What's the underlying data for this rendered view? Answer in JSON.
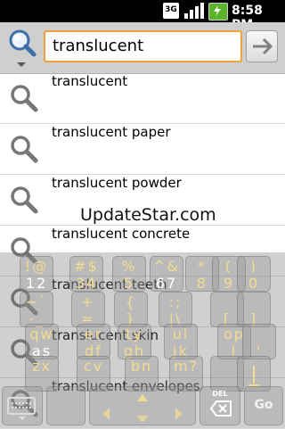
{
  "status_bar": {
    "network": "3G",
    "time": "8:58 PM"
  },
  "search": {
    "query": "translucent"
  },
  "suggestions": [
    {
      "text": "translucent"
    },
    {
      "text": "translucent paper"
    },
    {
      "text": "translucent powder"
    },
    {
      "text": "translucent concrete"
    },
    {
      "text": "translucent teeth"
    },
    {
      "text": "translucent skin"
    },
    {
      "text": "translucent envelopes"
    }
  ],
  "watermark": "UpdateStar.com",
  "keyboard": {
    "row1": [
      {
        "top": "!@",
        "bottom": "12"
      },
      {
        "top": "#$",
        "bottom": "34"
      },
      {
        "top": "%",
        "bottom": "5"
      },
      {
        "top": "^&",
        "bottom": "67"
      },
      {
        "top": "*",
        "bottom": "8"
      },
      {
        "top": "(",
        "bottom": "9"
      },
      {
        "top": ")",
        "bottom": "0"
      }
    ],
    "row2": [
      {
        "top": "~`",
        "bottom": "-_"
      },
      {
        "top": "+",
        "bottom": "="
      },
      {
        "top": "{",
        "bottom": "}"
      },
      {
        "top": ":;",
        "bottom": "|\\"
      },
      {
        "top": "",
        "bottom": "["
      },
      {
        "top": "",
        "bottom": "]"
      }
    ],
    "row3": [
      {
        "top": "qw",
        "bottom": "as"
      },
      {
        "top": "er",
        "bottom": "df"
      },
      {
        "top": "ty",
        "bottom": "gh"
      },
      {
        "top": "ui",
        "bottom": "jk"
      },
      {
        "top": "op",
        "bottom": "l"
      },
      {
        "top": "",
        "bottom": "'"
      }
    ],
    "row4": [
      {
        "top": "zx",
        "bottom": ""
      },
      {
        "top": "cv",
        "bottom": ""
      },
      {
        "top": "bn",
        "bottom": ""
      },
      {
        "top": "m?",
        "bottom": ""
      },
      {
        "top": "",
        "bottom": ""
      },
      {
        "top": "",
        "bottom": ""
      }
    ],
    "del_label": "DEL",
    "go_label": "Go",
    "colors": {
      "accent": "#f2dc90",
      "field_border": "#f2a03a",
      "battery": "#5ab52a"
    }
  }
}
